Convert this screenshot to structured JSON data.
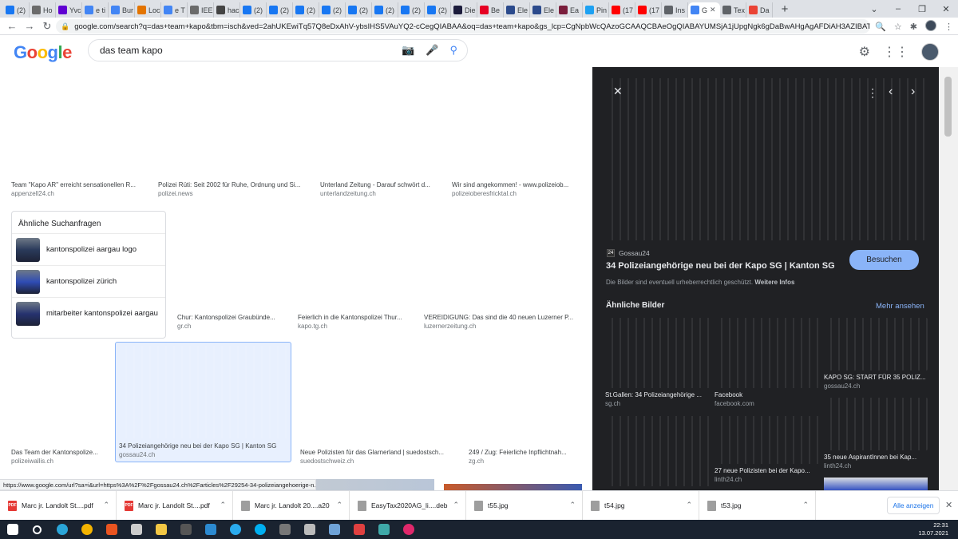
{
  "browser": {
    "tabs": [
      {
        "label": "(2)",
        "icon": "facebook-icon",
        "color": "#1877f2"
      },
      {
        "label": "Ho",
        "icon": "web-icon",
        "color": "#6b6b6b"
      },
      {
        "label": "Yvc",
        "icon": "yahoo-icon",
        "color": "#6001d2"
      },
      {
        "label": "e ti",
        "icon": "google-icon",
        "color": "#4285f4"
      },
      {
        "label": "Bur",
        "icon": "google-icon",
        "color": "#4285f4"
      },
      {
        "label": "Loc",
        "icon": "bookmark-icon",
        "color": "#e37400"
      },
      {
        "label": "e T",
        "icon": "google-icon",
        "color": "#4285f4"
      },
      {
        "label": "IEE",
        "icon": "doc-icon",
        "color": "#6b6b6b"
      },
      {
        "label": "hac",
        "icon": "web-icon",
        "color": "#444444"
      },
      {
        "label": "(2)",
        "icon": "facebook-icon",
        "color": "#1877f2"
      },
      {
        "label": "(2)",
        "icon": "facebook-icon",
        "color": "#1877f2"
      },
      {
        "label": "(2)",
        "icon": "facebook-icon",
        "color": "#1877f2"
      },
      {
        "label": "(2)",
        "icon": "facebook-icon",
        "color": "#1877f2"
      },
      {
        "label": "(2)",
        "icon": "facebook-icon",
        "color": "#1877f2"
      },
      {
        "label": "(2)",
        "icon": "facebook-icon",
        "color": "#1877f2"
      },
      {
        "label": "(2)",
        "icon": "facebook-icon",
        "color": "#1877f2"
      },
      {
        "label": "(2)",
        "icon": "facebook-icon",
        "color": "#1877f2"
      },
      {
        "label": "Die",
        "icon": "news-icon",
        "color": "#1c1c3c"
      },
      {
        "label": "Be",
        "icon": "pinterest-icon",
        "color": "#e60023"
      },
      {
        "label": "Ele",
        "icon": "doc-icon",
        "color": "#2b4a8c"
      },
      {
        "label": "Ele",
        "icon": "doc-icon",
        "color": "#2b4a8c"
      },
      {
        "label": "Ea",
        "icon": "web-icon",
        "color": "#7a1e3c"
      },
      {
        "label": "Pin",
        "icon": "twitter-icon",
        "color": "#1da1f2"
      },
      {
        "label": "(17",
        "icon": "youtube-icon",
        "color": "#ff0000"
      },
      {
        "label": "(17",
        "icon": "youtube-icon",
        "color": "#ff0000"
      },
      {
        "label": "Ins",
        "icon": "globe-icon",
        "color": "#5f6368"
      }
    ],
    "active_tab": {
      "label": "G",
      "close": "✕",
      "icon": "google-icon",
      "color": "#4285f4"
    },
    "tabs_after": [
      {
        "label": "Tex",
        "icon": "globe-icon",
        "color": "#5f6368"
      },
      {
        "label": "Da",
        "icon": "drive-icon",
        "color": "#ea4335"
      }
    ],
    "new_tab": "+",
    "window_controls": [
      "⌄",
      "–",
      "❐",
      "✕"
    ],
    "url": "google.com/search?q=das+team+kapo&tbm=isch&ved=2ahUKEwiTq57Q8eDxAhV-ybsIHS5VAuYQ2-cCegQIABAA&oq=das+team+kapo&gs_lcp=CgNpbWcQAzoGCAAQCBAeOgQIABAYUMSjA1jUpgNgk6gDaBwAHgAgAFDiAH3AZIBATSYAQCgAQGgAQtnd...",
    "nav": {
      "back": "←",
      "forward": "→",
      "reload": "↻"
    }
  },
  "google": {
    "logo": [
      "G",
      "o",
      "o",
      "g",
      "l",
      "e"
    ],
    "logo_colors": [
      "#4285f4",
      "#ea4335",
      "#fbbc05",
      "#4285f4",
      "#34a853",
      "#ea4335"
    ],
    "query": "das team kapo"
  },
  "results": [
    {
      "caption": "Team \"Kapo AR\" erreicht sensationellen R...",
      "source": "appenzell24.ch",
      "style": "sport"
    },
    {
      "caption": "Polizei Rüti: Seit 2002 für Ruhe, Ordnung und Si...",
      "source": "polizei.news",
      "style": "outdoor"
    },
    {
      "caption": "Unterland Zeitung - Darauf schwört d...",
      "source": "unterlandzeitung.ch",
      "style": "field"
    },
    {
      "caption": "Wir sind angekommen! - www.polizeiob...",
      "source": "polizeioberesfricktal.ch",
      "style": "bluegrp"
    },
    {
      "caption": "Chur: Kantonspolizei Graubünde...",
      "source": "gr.ch",
      "style": "bluegrp2"
    },
    {
      "caption": "Feierlich in die Kantonspolizei Thur...",
      "source": "kapo.tg.ch",
      "style": "bluegrp"
    },
    {
      "caption": "VEREIDIGUNG: Das sind die 40 neuen Luzerner P...",
      "source": "luzernerzeitung.ch",
      "style": "bluegrp"
    },
    {
      "caption": "Das Team der Kantonspolize...",
      "source": "polizeiwallis.ch",
      "style": "field"
    },
    {
      "caption": "34 Polizeiangehörige neu bei der Kapo SG | Kanton SG",
      "source": "gossau24.ch",
      "style": "hall"
    },
    {
      "caption": "Neue Polizisten für das Glarnerland | suedostsch...",
      "source": "suedostschweiz.ch",
      "style": "indoor"
    },
    {
      "caption": "249 / Zug: Feierliche Inpflichtnah...",
      "source": "zg.ch",
      "style": "bluegrp"
    }
  ],
  "related": {
    "title": "Ähnliche Suchanfragen",
    "items": [
      {
        "label": "kantonspolizei aargau logo"
      },
      {
        "label": "kantonspolizei zürich"
      },
      {
        "label": "mitarbeiter kantonspolizei aargau"
      }
    ]
  },
  "status_url": "https://www.google.com/url?sa=i&url=https%3A%2F%2Fgossau24.ch%2Farticles%2F29254-34-polizeiangehoerige-n...",
  "preview": {
    "site_logo": "24",
    "site": "Gossau24",
    "title": "34 Polizeiangehörige neu bei der Kapo SG | Kanton SG",
    "visit": "Besuchen",
    "copyright": "Die Bilder sind eventuell urheberrechtlich geschützt.",
    "more_info": "Weitere Infos",
    "similar_title": "Ähnliche Bilder",
    "see_more": "Mehr ansehen",
    "controls": {
      "close": "✕",
      "menu": "⋮",
      "prev": "‹",
      "next": "›"
    },
    "similar": [
      {
        "title": "St.Gallen: 34 Polizeiangehörige ...",
        "source": "sg.ch",
        "style": "hall"
      },
      {
        "title": "Facebook",
        "source": "facebook.com",
        "style": "bluegrp2"
      },
      {
        "title": "KAPO SG: START FÜR 35 POLIZ...",
        "source": "gossau24.ch",
        "style": "bluegrp"
      },
      {
        "title": "",
        "source": "",
        "style": "bluegrp"
      },
      {
        "title": "27 neue Polizisten bei der Kapo...",
        "source": "linth24.ch",
        "style": "bluegrp"
      },
      {
        "title": "35 neue AspirantInnen bei Kap...",
        "source": "linth24.ch",
        "style": "field"
      }
    ]
  },
  "downloads": {
    "items": [
      {
        "name": "Marc jr. Landolt St....pdf",
        "type": "PDF",
        "color": "#e53935"
      },
      {
        "name": "Marc jr. Landolt St....pdf",
        "type": "PDF",
        "color": "#e53935"
      },
      {
        "name": "Marc jr. Landolt 20....a20",
        "type": "",
        "color": "#9e9e9e"
      },
      {
        "name": "EasyTax2020AG_li....deb",
        "type": "",
        "color": "#9e9e9e"
      },
      {
        "name": "t55.jpg",
        "type": "",
        "color": "#9e9e9e"
      },
      {
        "name": "t54.jpg",
        "type": "",
        "color": "#9e9e9e"
      },
      {
        "name": "t53.jpg",
        "type": "",
        "color": "#9e9e9e"
      }
    ],
    "show_all": "Alle anzeigen",
    "close": "✕"
  },
  "taskbar": {
    "apps": [
      {
        "icon": "windows-start-icon",
        "color": "#ffffff"
      },
      {
        "icon": "search-icon",
        "color": "#ffffff"
      },
      {
        "icon": "edge-icon",
        "color": "#2aa5d8"
      },
      {
        "icon": "chrome-icon",
        "color": "#f4b400"
      },
      {
        "icon": "ubuntu-icon",
        "color": "#e95420"
      },
      {
        "icon": "terminal-icon",
        "color": "#cccccc"
      },
      {
        "icon": "explorer-icon",
        "color": "#f2c744"
      },
      {
        "icon": "app-icon",
        "color": "#555555"
      },
      {
        "icon": "mail-icon",
        "color": "#2c8ad0"
      },
      {
        "icon": "telegram-icon",
        "color": "#2aabee"
      },
      {
        "icon": "skype-icon",
        "color": "#00aff0"
      },
      {
        "icon": "calculator-icon",
        "color": "#777777"
      },
      {
        "icon": "tool-icon",
        "color": "#bbbbbb"
      },
      {
        "icon": "notepad-icon",
        "color": "#6fa3d8"
      },
      {
        "icon": "music-icon",
        "color": "#e04040"
      },
      {
        "icon": "video-icon",
        "color": "#3fa9a9"
      },
      {
        "icon": "app2-icon",
        "color": "#e0286b"
      }
    ],
    "time": "22:31",
    "date": "13.07.2021"
  }
}
